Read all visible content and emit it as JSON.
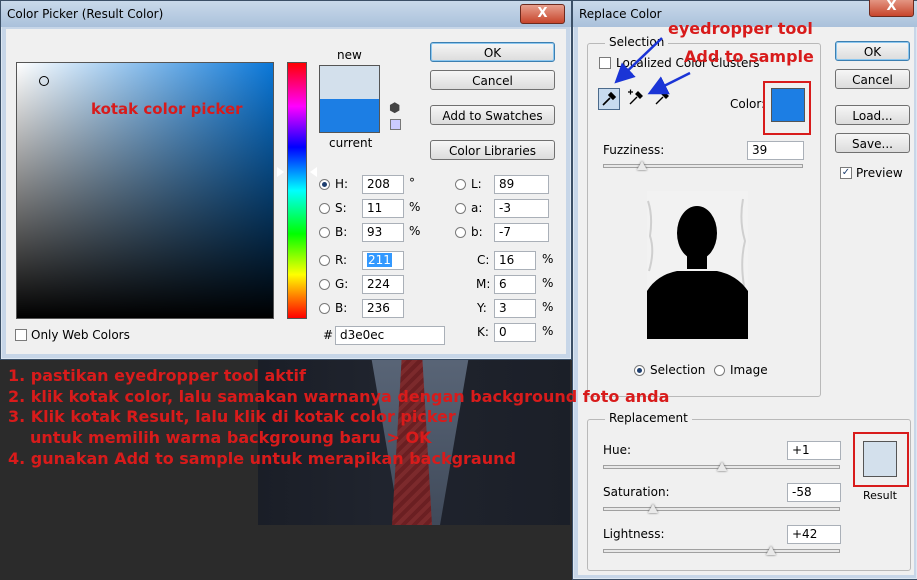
{
  "colorPicker": {
    "title": "Color Picker (Result Color)",
    "close": "X",
    "new_label": "new",
    "current_label": "current",
    "new_color": "#d3e0ec",
    "current_color": "#1c7ee4",
    "buttons": {
      "ok": "OK",
      "cancel": "Cancel",
      "add_swatches": "Add to Swatches",
      "color_libraries": "Color Libraries"
    },
    "fields": {
      "H": {
        "label": "H:",
        "value": "208",
        "unit": "°"
      },
      "S": {
        "label": "S:",
        "value": "11",
        "unit": "%"
      },
      "B": {
        "label": "B:",
        "value": "93",
        "unit": "%"
      },
      "R": {
        "label": "R:",
        "value": "211"
      },
      "G": {
        "label": "G:",
        "value": "224"
      },
      "Bv": {
        "label": "B:",
        "value": "236"
      },
      "L": {
        "label": "L:",
        "value": "89"
      },
      "a": {
        "label": "a:",
        "value": "-3"
      },
      "b": {
        "label": "b:",
        "value": "-7"
      },
      "C": {
        "label": "C:",
        "value": "16",
        "unit": "%"
      },
      "M": {
        "label": "M:",
        "value": "6",
        "unit": "%"
      },
      "Y": {
        "label": "Y:",
        "value": "3",
        "unit": "%"
      },
      "K": {
        "label": "K:",
        "value": "0",
        "unit": "%"
      }
    },
    "hex_label": "#",
    "hex_value": "d3e0ec",
    "only_web_colors": "Only Web Colors",
    "field_hue": "#0a77d8"
  },
  "replaceColor": {
    "title": "Replace Color",
    "close": "X",
    "selection_group": "Selection",
    "localized_clusters": "Localized Color Clusters",
    "color_label": "Color:",
    "sample_color": "#1c7ee4",
    "fuzziness_label": "Fuzziness:",
    "fuzziness_value": "39",
    "fuzziness_level": 0.195,
    "radio_selection": "Selection",
    "radio_image": "Image",
    "buttons": {
      "ok": "OK",
      "cancel": "Cancel",
      "load": "Load...",
      "save": "Save..."
    },
    "preview_label": "Preview",
    "replacement_group": "Replacement",
    "hue_label": "Hue:",
    "hue_value": "+1",
    "hue_level": 0.5,
    "saturation_label": "Saturation:",
    "saturation_value": "-58",
    "saturation_level": 0.21,
    "lightness_label": "Lightness:",
    "lightness_value": "+42",
    "lightness_level": 0.71,
    "result_label": "Result",
    "result_color": "#d3e0ec"
  },
  "annotations": {
    "picker_box": "kotak color picker",
    "eyedropper": "eyedropper tool",
    "add_sample": "Add to sample",
    "step1": "1. pastikan eyedropper tool aktif",
    "step2": "2. klik kotak color, lalu samakan warnanya dengan background foto anda",
    "step3": "3. Klik kotak Result, lalu klik di kotak color picker",
    "step3b": "untuk memilih warna backgroung baru > OK",
    "step4": "4. gunakan Add to sample untuk merapikan backgraund"
  },
  "colors": {
    "annotation_red": "#d81b1b",
    "arrow_blue": "#1a34d6"
  }
}
